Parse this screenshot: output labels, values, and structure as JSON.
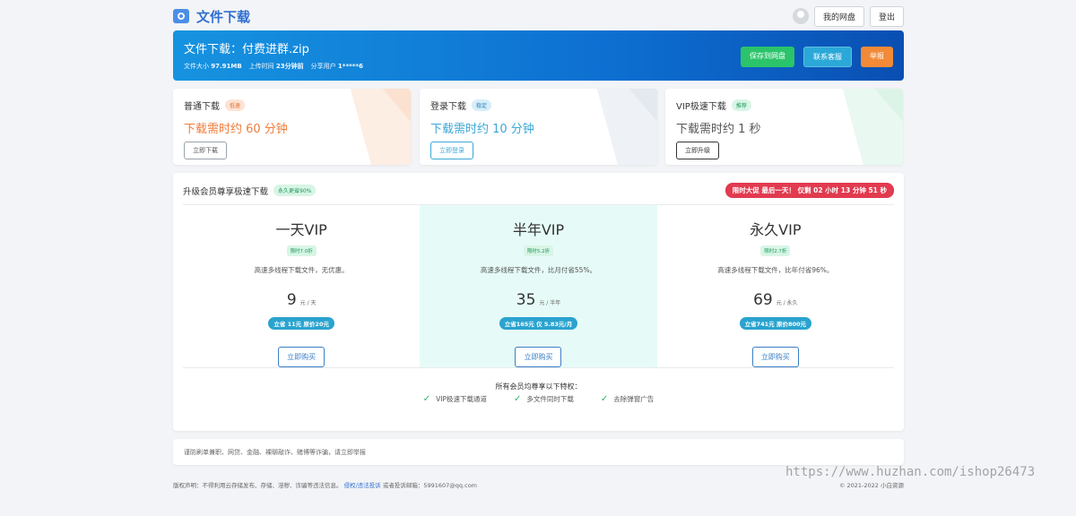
{
  "brand": {
    "title": "文件下载"
  },
  "top_actions": {
    "my_disk": "我的网盘",
    "logout": "登出"
  },
  "banner": {
    "title": "文件下载：付费进群.zip",
    "size_label": "文件大小",
    "size_value": "97.91MB",
    "upload_label": "上传时间",
    "upload_value": "23分钟前",
    "sharer_label": "分享用户",
    "sharer_value": "1*****6",
    "save_btn": "保存到网盘",
    "contact_btn": "联系客服",
    "report_btn": "举报"
  },
  "cards": [
    {
      "title": "普通下载",
      "tag": "低速",
      "time": "下载需时约 60 分钟",
      "button": "立即下载"
    },
    {
      "title": "登录下载",
      "tag": "稳定",
      "time": "下载需时约 10 分钟",
      "button": "立即登录"
    },
    {
      "title": "VIP极速下载",
      "tag": "推荐",
      "time": "下载需时约 1 秒",
      "button": "立即升级"
    }
  ],
  "vip": {
    "title": "升级会员尊享极速下载",
    "title_tag": "永久更省90%",
    "countdown": "限时大促 最后一天！ 仅剩 02 小时 13 分钟 51 秒",
    "plans": [
      {
        "name": "一天VIP",
        "tag": "限时7.0折",
        "desc": "高速多线程下载文件，无优惠。",
        "price": "9",
        "unit": "元 / 天",
        "save": "立省 11元 原价20元",
        "buy": "立即购买"
      },
      {
        "name": "半年VIP",
        "tag": "限时5.2折",
        "desc": "高速多线程下载文件，比月付省55%。",
        "price": "35",
        "unit": "元 / 半年",
        "save": "立省165元 仅 5.83元/月",
        "buy": "立即购买"
      },
      {
        "name": "永久VIP",
        "tag": "限时2.7折",
        "desc": "高速多线程下载文件，比年付省96%。",
        "price": "69",
        "unit": "元 / 永久",
        "save": "立省741元 原价800元",
        "buy": "立即购买"
      }
    ],
    "perks_title": "所有会员均尊享以下特权：",
    "perks": [
      "VIP极速下载通道",
      "多文件同时下载",
      "去除弹窗广告"
    ]
  },
  "notice": {
    "text": "谨防刷单兼职、网贷、金融、裸聊敲诈、赌博等诈骗，请立即举报"
  },
  "footer": {
    "left_text": "版权声明：不得利用云存储发布、存储、淫秽、诈骗等违法信息。",
    "report_link": "侵权/违法投诉",
    "email_text": "或者投诉邮箱：5991607@qq.com",
    "right_text": "© 2021-2022 小白资源"
  },
  "watermark": "https://www.huzhan.com/ishop26473"
}
